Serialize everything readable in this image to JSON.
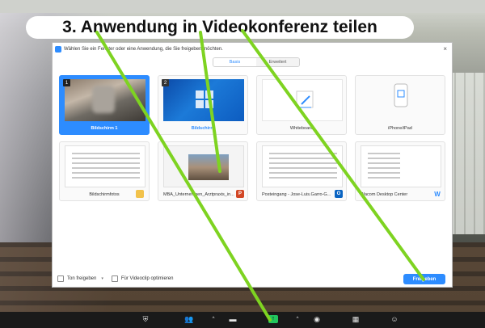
{
  "slide_title": "3. Anwendung in Videokonferenz teilen",
  "dialog": {
    "title": "Wählen Sie ein Fenster oder eine Anwendung, die Sie freigeben möchten.",
    "close": "×",
    "tabs": [
      {
        "label": "Basis"
      },
      {
        "label": "Erweitert"
      }
    ],
    "tiles": [
      {
        "label": "Bildschirm 1",
        "badge": "1"
      },
      {
        "label": "Bildschirm",
        "badge": "2"
      },
      {
        "label": "Whiteboard"
      },
      {
        "label": "iPhone/iPad"
      },
      {
        "label": "Bildschirmfotos"
      },
      {
        "label": "MBA_Unternehmen_Arztpraxis_in...",
        "app_badge": "P"
      },
      {
        "label": "Posteingang - Jose-Luis.Garro-G...",
        "app_badge": "O"
      },
      {
        "label": "Wacom Desktop Center",
        "app_badge": "W"
      }
    ],
    "footer": {
      "share_sound": "Ton freigeben",
      "optimize_video": "Für Videoclip optimieren",
      "share_button": "Freigeben"
    }
  },
  "colors": {
    "accent": "#2d8cff",
    "annotation": "#7ed321",
    "share_green": "#22c55e"
  }
}
